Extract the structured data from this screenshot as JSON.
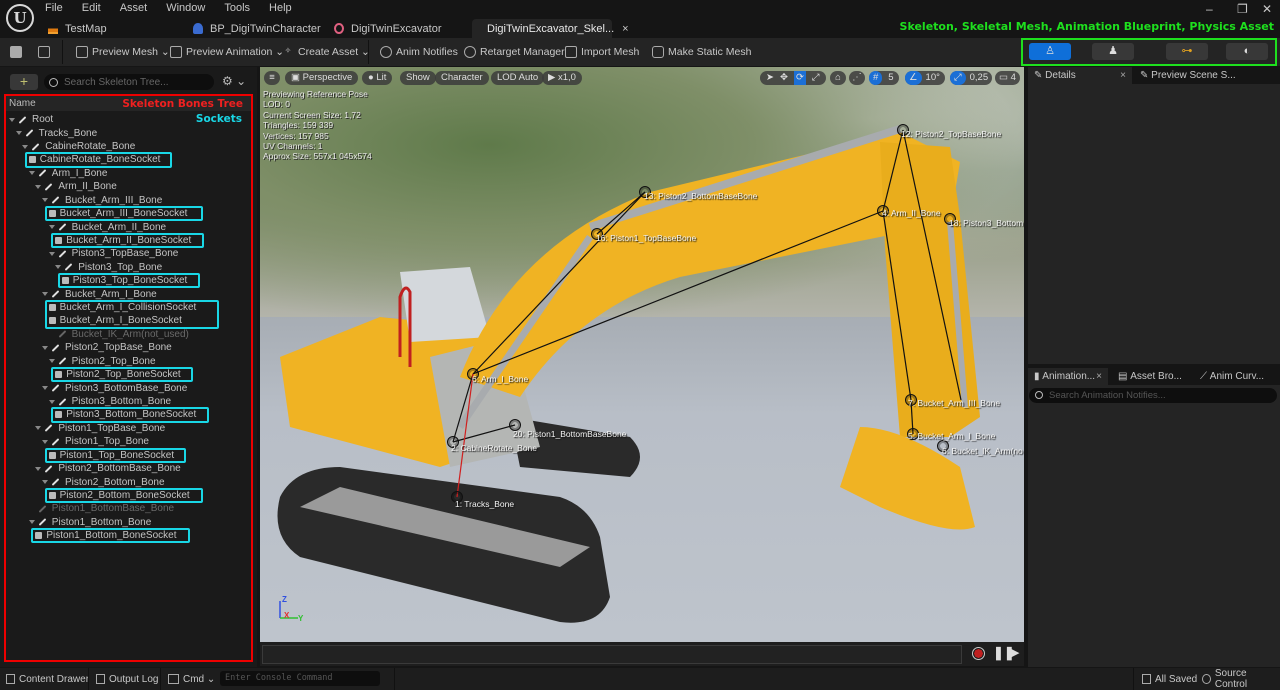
{
  "titlebar": {
    "logo": "U",
    "menu": [
      "File",
      "Edit",
      "Asset",
      "Window",
      "Tools",
      "Help"
    ],
    "tabs": [
      {
        "label": "TestMap",
        "icon": "map-icon"
      },
      {
        "label": "BP_DigiTwinCharacter",
        "icon": "character-blueprint-icon"
      },
      {
        "label": "DigiTwinExcavator",
        "icon": "skeletal-mesh-icon"
      },
      {
        "label": "DigiTwinExcavator_Skel...",
        "icon": "skeleton-icon",
        "close": "×",
        "active": true
      }
    ],
    "window_controls": {
      "minimize": "–",
      "restore": "❐",
      "close": "✕"
    },
    "annotation": "Skeleton, Skeletal Mesh, Animation Blueprint, Physics Asset"
  },
  "toolbar": {
    "items": [
      {
        "label": "Preview Mesh",
        "dropdown": true
      },
      {
        "label": "Preview Animation",
        "dropdown": true
      },
      {
        "label": "Create Asset",
        "dropdown": true
      },
      {
        "label": "Anim Notifies"
      },
      {
        "label": "Retarget Manager"
      },
      {
        "label": "Import Mesh"
      },
      {
        "label": "Make Static Mesh"
      }
    ],
    "mode_buttons": [
      {
        "name": "skeleton",
        "active": true
      },
      {
        "name": "skeletal-mesh",
        "active": false
      },
      {
        "name": "animation-blueprint",
        "active": false
      },
      {
        "name": "physics-asset",
        "active": false
      }
    ]
  },
  "skeleton_tree": {
    "search_placeholder": "Search Skeleton Tree...",
    "column_header": "Name",
    "annotation_tree": "Skeleton Bones Tree",
    "annotation_sockets": "Sockets",
    "rows": [
      {
        "label": "Root",
        "type": "bone",
        "depth": 0
      },
      {
        "label": "Tracks_Bone",
        "type": "bone",
        "depth": 1
      },
      {
        "label": "CabineRotate_Bone",
        "type": "bone",
        "depth": 2
      },
      {
        "label": "CabineRotate_BoneSocket",
        "type": "socket",
        "depth": 3
      },
      {
        "label": "Arm_I_Bone",
        "type": "bone",
        "depth": 3
      },
      {
        "label": "Arm_II_Bone",
        "type": "bone",
        "depth": 4
      },
      {
        "label": "Bucket_Arm_III_Bone",
        "type": "bone",
        "depth": 5
      },
      {
        "label": "Bucket_Arm_III_BoneSocket",
        "type": "socket",
        "depth": 6
      },
      {
        "label": "Bucket_Arm_II_Bone",
        "type": "bone",
        "depth": 6
      },
      {
        "label": "Bucket_Arm_II_BoneSocket",
        "type": "socket",
        "depth": 7
      },
      {
        "label": "Piston3_TopBase_Bone",
        "type": "bone",
        "depth": 6
      },
      {
        "label": "Piston3_Top_Bone",
        "type": "bone",
        "depth": 7
      },
      {
        "label": "Piston3_Top_BoneSocket",
        "type": "socket",
        "depth": 8
      },
      {
        "label": "Bucket_Arm_I_Bone",
        "type": "bone",
        "depth": 5
      },
      {
        "label": "Bucket_Arm_I_CollisionSocket",
        "type": "socket",
        "depth": 6
      },
      {
        "label": "Bucket_Arm_I_BoneSocket",
        "type": "socket",
        "depth": 6
      },
      {
        "label": "Bucket_IK_Arm(not_used)",
        "type": "bone",
        "depth": 6,
        "dim": true
      },
      {
        "label": "Piston2_TopBase_Bone",
        "type": "bone",
        "depth": 5
      },
      {
        "label": "Piston2_Top_Bone",
        "type": "bone",
        "depth": 6
      },
      {
        "label": "Piston2_Top_BoneSocket",
        "type": "socket",
        "depth": 7
      },
      {
        "label": "Piston3_BottomBase_Bone",
        "type": "bone",
        "depth": 5
      },
      {
        "label": "Piston3_Bottom_Bone",
        "type": "bone",
        "depth": 6
      },
      {
        "label": "Piston3_Bottom_BoneSocket",
        "type": "socket",
        "depth": 7
      },
      {
        "label": "Piston1_TopBase_Bone",
        "type": "bone",
        "depth": 4
      },
      {
        "label": "Piston1_Top_Bone",
        "type": "bone",
        "depth": 5
      },
      {
        "label": "Piston1_Top_BoneSocket",
        "type": "socket",
        "depth": 6
      },
      {
        "label": "Piston2_BottomBase_Bone",
        "type": "bone",
        "depth": 4
      },
      {
        "label": "Piston2_Bottom_Bone",
        "type": "bone",
        "depth": 5
      },
      {
        "label": "Piston2_Bottom_BoneSocket",
        "type": "socket",
        "depth": 6
      },
      {
        "label": "Piston1_BottomBase_Bone",
        "type": "bone",
        "depth": 3,
        "dim": true
      },
      {
        "label": "Piston1_Bottom_Bone",
        "type": "bone",
        "depth": 3
      },
      {
        "label": "Piston1_Bottom_BoneSocket",
        "type": "socket",
        "depth": 4
      }
    ]
  },
  "viewport": {
    "toolbar_left": [
      "Perspective",
      "Lit",
      "Show",
      "Character",
      "LOD Auto",
      "x1,0"
    ],
    "toolbar_right": {
      "grid_snap": "5",
      "rotation_snap": "10°",
      "scale_snap": "0,25",
      "camera_speed": "4"
    },
    "info": [
      "Previewing Reference Pose",
      "LOD: 0",
      "Current Screen Size: 1,72",
      "Triangles: 159 339",
      "Vertices: 157 985",
      "UV Channels: 1",
      "Approx Size: 557x1 045x574"
    ],
    "bone_labels": [
      "12: Piston2_TopBaseBone",
      "13: Piston2_BottomBaseBone",
      "16: Piston1_TopBaseBone",
      "4: Arm_II_Bone",
      "18: Piston3_Bottom",
      "6: Arm_I_Bone",
      "20: Piston1_BottomBaseBone",
      "2: CabineRotate_Bone",
      "1: Tracks_Bone",
      "7: Bucket_Arm_III_Bone",
      "5: Bucket_Arm_I_Bone",
      "6: Bucket_IK_Arm(no"
    ],
    "axis": {
      "z": "Z",
      "x": "X",
      "y": "Y"
    }
  },
  "right_panel": {
    "top_tabs": [
      {
        "label": "Details",
        "close": "×",
        "active": true
      },
      {
        "label": "Preview Scene S...",
        "active": false
      }
    ],
    "bottom_tabs": [
      {
        "label": "Animation...",
        "close": "×",
        "active": true
      },
      {
        "label": "Asset Bro...",
        "active": false
      },
      {
        "label": "Anim Curv...",
        "active": false
      }
    ],
    "notify_search_placeholder": "Search Animation Notifies..."
  },
  "statusbar": {
    "content_drawer": "Content Drawer",
    "output_log": "Output Log",
    "cmd": "Cmd",
    "console_placeholder": "Enter Console Command",
    "all_saved": "All Saved",
    "source_control": "Source Control"
  },
  "colors": {
    "accent_blue": "#0f6fd9",
    "annotation_green": "#1ee01e",
    "annotation_red": "#f02020",
    "annotation_cyan": "#19d7e6",
    "excavator_yellow": "#f0b323"
  }
}
